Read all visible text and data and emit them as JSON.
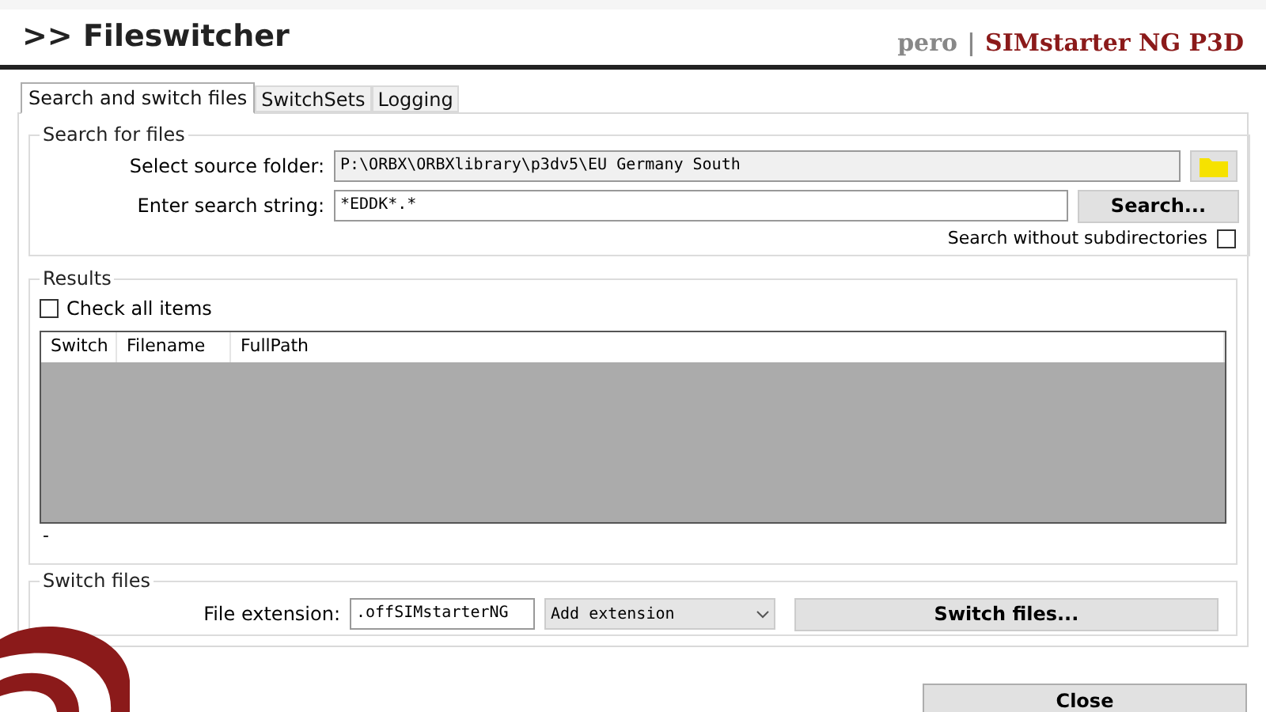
{
  "header": {
    "title": ">> Fileswitcher",
    "user": "pero",
    "separator": "|",
    "product": "SIMstarter NG P3D"
  },
  "tabs": [
    {
      "label": "Search and switch files",
      "selected": true
    },
    {
      "label": "SwitchSets",
      "selected": false
    },
    {
      "label": "Logging",
      "selected": false
    }
  ],
  "search": {
    "legend": "Search for files",
    "folder_label": "Select source folder:",
    "folder_value": "P:\\ORBX\\ORBXlibrary\\p3dv5\\EU Germany South",
    "string_label": "Enter search string:",
    "string_value": "*EDDK*.*",
    "search_button": "Search...",
    "subdirs_label": "Search without subdirectories",
    "subdirs_checked": false
  },
  "results": {
    "legend": "Results",
    "check_all_label": "Check all items",
    "check_all_checked": false,
    "columns": [
      "Switch",
      "Filename",
      "FullPath"
    ],
    "status": "-"
  },
  "switch": {
    "legend": "Switch files",
    "extension_label": "File extension:",
    "extension_value": ".offSIMstarterNG",
    "mode": "Add extension",
    "switch_button": "Switch files..."
  },
  "close_button": "Close"
}
